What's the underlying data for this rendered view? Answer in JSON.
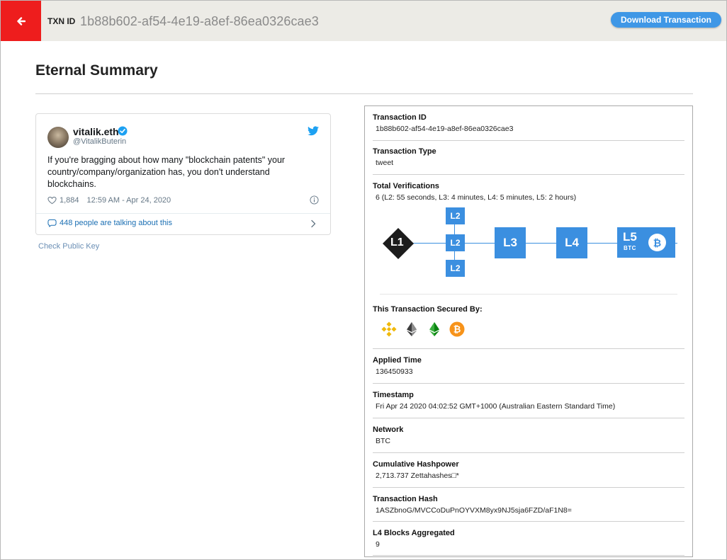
{
  "header": {
    "back_icon": "arrow-left-icon",
    "txn_label": "TXN ID",
    "txn_id": "1b88b602-af54-4e19-a8ef-86ea0326cae3",
    "download_label": "Download Transaction",
    "accent": "#ee1d1d",
    "button_color": "#3f97e6"
  },
  "page": {
    "title": "Eternal Summary",
    "check_public_key": "Check Public Key"
  },
  "tweet": {
    "name": "vitalik.eth",
    "handle": "@VitalikButerin",
    "text": "If you're bragging about how many \"blockchain patents\" your country/company/organization has, you don't understand blockchains.",
    "likes": "1,884",
    "datetime": "12:59 AM - Apr 24, 2020",
    "talking": "448 people are talking about this",
    "icons": [
      "verified-icon",
      "twitter-bird-icon",
      "heart-icon",
      "info-icon",
      "comment-icon",
      "chevron-right-icon"
    ]
  },
  "details": {
    "transaction_id": {
      "label": "Transaction ID",
      "value": "1b88b602-af54-4e19-a8ef-86ea0326cae3"
    },
    "transaction_type": {
      "label": "Transaction Type",
      "value": "tweet"
    },
    "total_verifications": {
      "label": "Total Verifications",
      "value": "6 (L2: 55 seconds, L3: 4 minutes, L4: 5 minutes, L5: 2 hours)"
    },
    "secured_by": {
      "label": "This Transaction Secured By:",
      "coins": [
        "binance-icon",
        "ethereum-classic-icon",
        "ethereum-icon",
        "bitcoin-icon"
      ]
    },
    "applied_time": {
      "label": "Applied Time",
      "value": "136450933"
    },
    "timestamp": {
      "label": "Timestamp",
      "value": "Fri Apr 24 2020 04:02:52 GMT+1000 (Australian Eastern Standard Time)"
    },
    "network": {
      "label": "Network",
      "value": "BTC"
    },
    "hashpower": {
      "label": "Cumulative Hashpower",
      "value": "2,713.737 Zettahashes□*"
    },
    "transaction_hash": {
      "label": "Transaction Hash",
      "value": "1ASZbnoG/MVCCoDuPnOYVXM8yx9NJ5sja6FZD/aF1N8="
    },
    "l4_blocks": {
      "label": "L4 Blocks Aggregated",
      "value": "9"
    }
  },
  "diagram": {
    "l1": "L1",
    "l2": [
      "L2",
      "L2",
      "L2"
    ],
    "l3": "L3",
    "l4": "L4",
    "l5": "L5",
    "l5_sub": "BTC",
    "l5_coin": "₿",
    "node_color": "#3b8fe0"
  }
}
